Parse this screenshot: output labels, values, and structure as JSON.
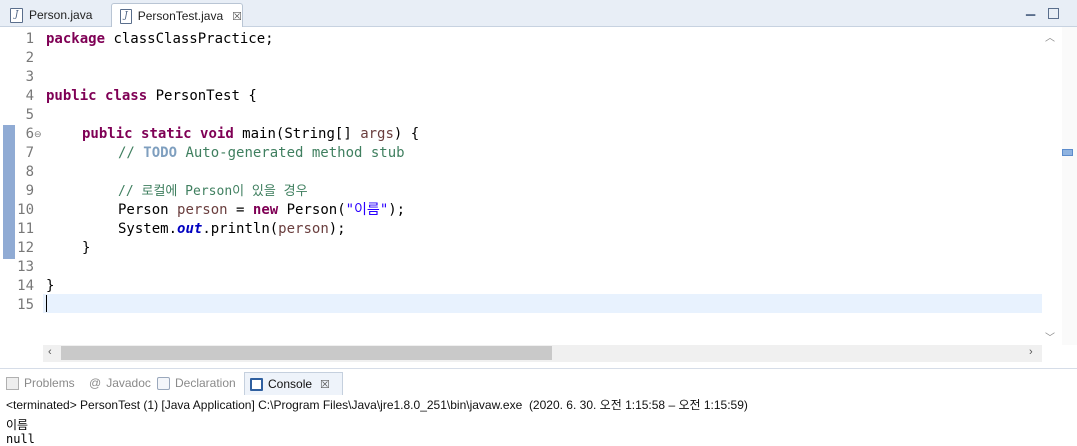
{
  "editor_tabs": [
    {
      "label": "Person.java",
      "active": false
    },
    {
      "label": "PersonTest.java",
      "active": true,
      "close": "☒"
    }
  ],
  "code_lines": [
    {
      "num": "1"
    },
    {
      "num": "2"
    },
    {
      "num": "3"
    },
    {
      "num": "4"
    },
    {
      "num": "5"
    },
    {
      "num": "6"
    },
    {
      "num": "7"
    },
    {
      "num": "8"
    },
    {
      "num": "9"
    },
    {
      "num": "10"
    },
    {
      "num": "11"
    },
    {
      "num": "12"
    },
    {
      "num": "13"
    },
    {
      "num": "14"
    },
    {
      "num": "15"
    }
  ],
  "code": {
    "l1_kw": "package",
    "l1_rest": " classClassPractice;",
    "l4_kw1": "public",
    "l4_kw2": "class",
    "l4_rest": " PersonTest {",
    "l6_kw1": "public",
    "l6_kw2": "static",
    "l6_kw3": "void",
    "l6_rest1": " main(String[] ",
    "l6_var": "args",
    "l6_rest2": ") {",
    "l7_c1": "// ",
    "l7_todo": "TODO",
    "l7_c2": " Auto-generated method stub",
    "l9_comment": "// 로컬에 Person이 있을 경우",
    "l10_t1": "Person ",
    "l10_var": "person",
    "l10_t2": " = ",
    "l10_kw": "new",
    "l10_t3": " Person(",
    "l10_str": "\"이름\"",
    "l10_t4": ");",
    "l11_t1": "System.",
    "l11_fld": "out",
    "l11_t2": ".println(",
    "l11_var": "person",
    "l11_t3": ");",
    "l12": "}",
    "l14": "}"
  },
  "views": {
    "problems": "Problems",
    "javadoc": "Javadoc",
    "declaration": "Declaration",
    "console": "Console"
  },
  "console": {
    "header": "<terminated> PersonTest (1) [Java Application] C:\\Program Files\\Java\\jre1.8.0_251\\bin\\javaw.exe  (2020. 6. 30. 오전 1:15:58 – 오전 1:15:59)",
    "output_line1": "이름",
    "output_line2": "null"
  },
  "colors": {
    "keyword": "#7f0055",
    "comment": "#3f7f5f",
    "string": "#2a00ff",
    "field": "#0000c0"
  }
}
